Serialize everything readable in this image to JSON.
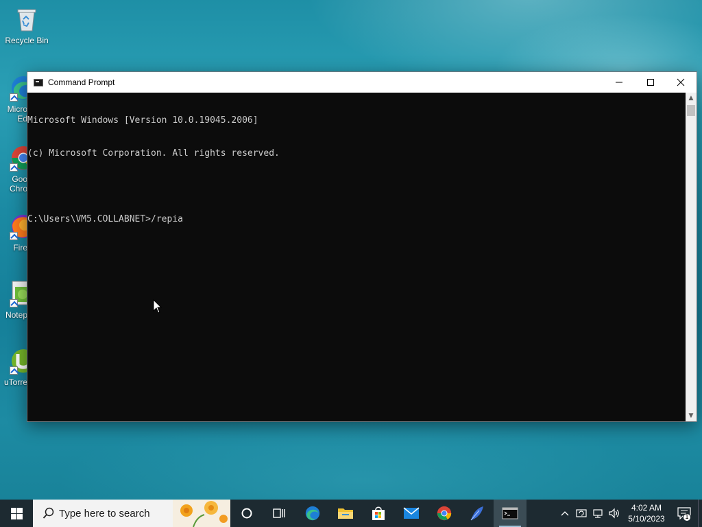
{
  "desktop": {
    "icons": [
      {
        "label": "Recycle Bin",
        "icon": "recycle-bin-icon"
      },
      {
        "label": "Micro\nEd",
        "icon": "edge-icon"
      },
      {
        "label": "Goo\nChro",
        "icon": "chrome-icon"
      },
      {
        "label": "Fire",
        "icon": "firefox-icon"
      },
      {
        "label": "Notep",
        "icon": "notepad-icon"
      },
      {
        "label": "uTorre",
        "icon": "utorrent-icon"
      }
    ]
  },
  "window": {
    "title": "Command Prompt",
    "lines": [
      "Microsoft Windows [Version 10.0.19045.2006]",
      "(c) Microsoft Corporation. All rights reserved.",
      "",
      "C:\\Users\\VM5.COLLABNET>/repia"
    ]
  },
  "taskbar": {
    "search_placeholder": "Type here to search",
    "apps": [
      "task-view",
      "edge",
      "file-explorer",
      "microsoft-store",
      "mail",
      "chrome",
      "feather-app",
      "command-prompt"
    ],
    "clock_time": "4:02 AM",
    "clock_date": "5/10/2023",
    "notification_count": "1"
  },
  "colors": {
    "console_bg": "#0c0c0c",
    "console_text": "#cccccc",
    "taskbar_bg": "#1d2a31"
  }
}
